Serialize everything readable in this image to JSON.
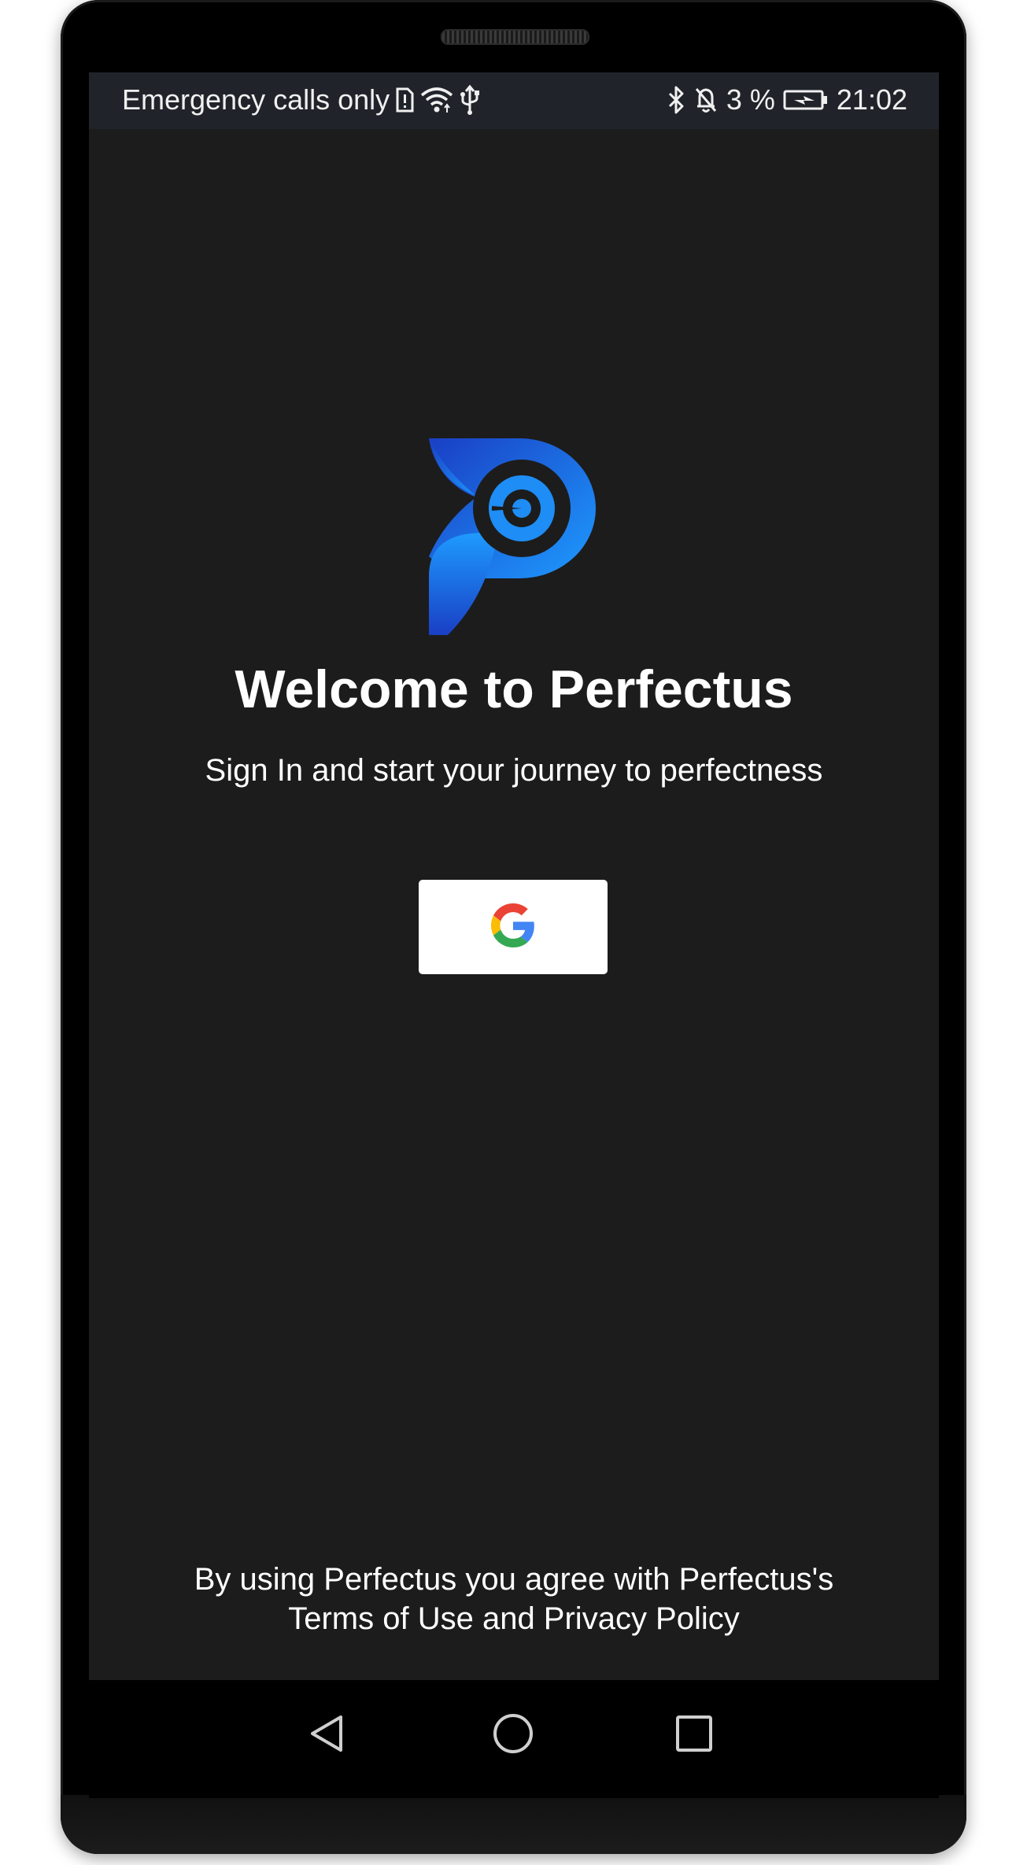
{
  "status_bar": {
    "carrier_text": "Emergency calls only",
    "battery_percent": "3 %",
    "time": "21:02",
    "icons": [
      "sim-alert-icon",
      "wifi-icon",
      "usb-icon",
      "bluetooth-icon",
      "bell-off-icon",
      "battery-charging-icon"
    ]
  },
  "app": {
    "logo_name": "perfectus-logo",
    "title": "Welcome to Perfectus",
    "subtitle": "Sign In and start your journey to perfectness",
    "google_button_icon": "google-g-icon",
    "footer_line1": "By using Perfectus you agree with Perfectus's",
    "footer_line2": "Terms of Use and Privacy Policy"
  },
  "nav_bar": {
    "buttons": [
      "back-icon",
      "home-icon",
      "recents-icon"
    ]
  },
  "colors": {
    "background": "#1c1c1c",
    "status_bar": "#20242a",
    "logo_blue_light": "#1e9bff",
    "logo_blue_dark": "#1a3fc4",
    "button_bg": "#ffffff",
    "text": "#ffffff"
  }
}
